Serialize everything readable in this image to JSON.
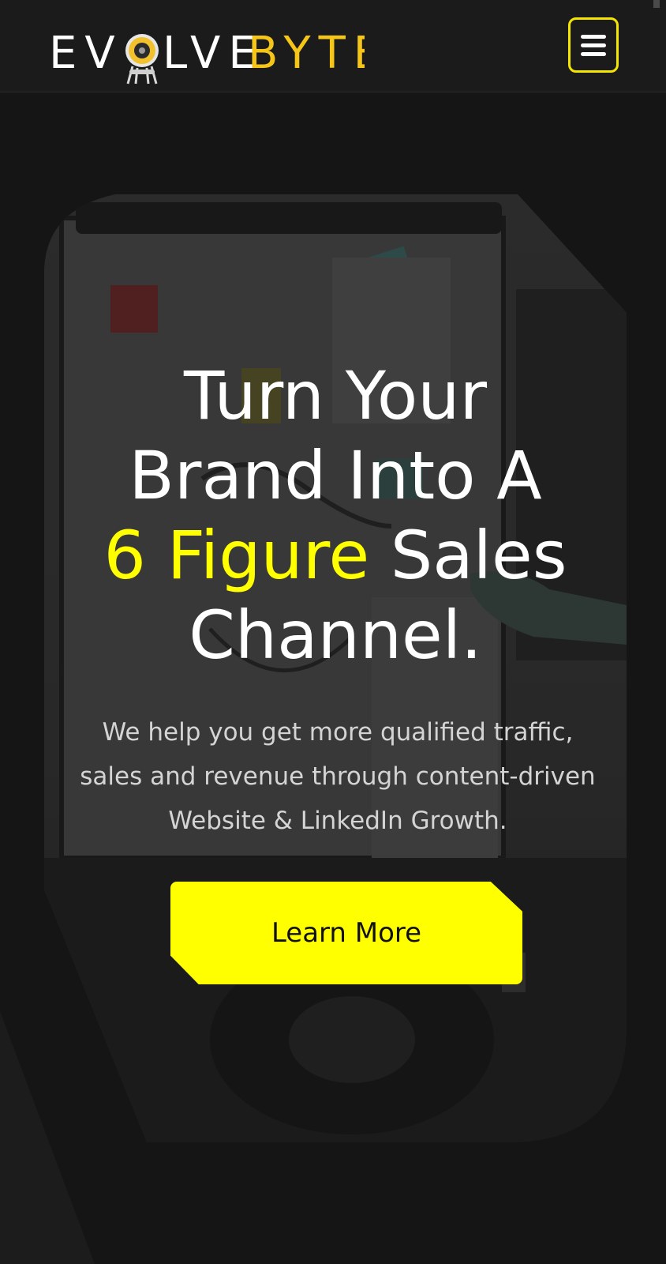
{
  "header": {
    "logo": {
      "part1": "EV",
      "part2": "LVE",
      "part3": "BYTE",
      "icon": "speaker-robot-icon"
    },
    "menu_icon": "hamburger-menu-icon"
  },
  "hero": {
    "title": {
      "line1": "Turn Your",
      "line2": "Brand Into A",
      "highlight": "6 Figure",
      "line3_rest": "Sales",
      "line4": "Channel."
    },
    "subtitle": {
      "line1": "We help you get more qualified traffic,",
      "line2": "sales and revenue through content-driven",
      "line3": "Website & LinkedIn Growth."
    },
    "cta_label": "Learn More",
    "background": "office whiteboard photo"
  },
  "colors": {
    "accent": "#ffff00",
    "logo_accent": "#f5c518",
    "background": "#151515",
    "text": "#ffffff"
  }
}
